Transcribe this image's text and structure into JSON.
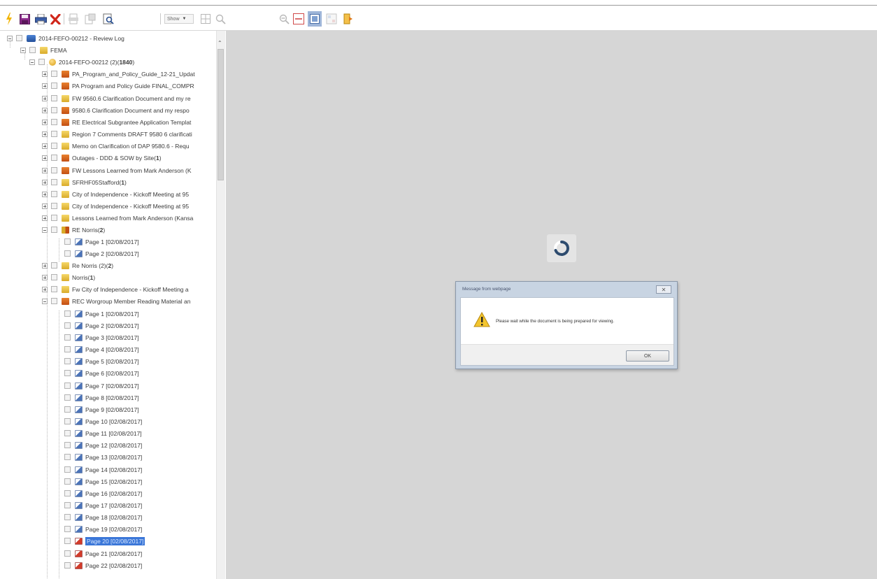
{
  "toolbar": {
    "show_label": "Show",
    "icons": [
      "lightning-icon",
      "save-icon",
      "print-icon",
      "delete-icon",
      "print-preview-icon",
      "export-icon",
      "search-document-icon",
      "grid-icon",
      "zoom-icon",
      "zoom-out-icon",
      "fit-width-icon",
      "fit-page-icon",
      "thumbnails-icon",
      "exit-icon"
    ]
  },
  "tree": {
    "root": "2014-FEFO-00212 - Review Log",
    "folder": "FEMA",
    "case_name": "2014-FEFO-00212 (2)(",
    "case_count": "1840",
    "items": [
      {
        "label": "PA_Program_and_Policy_Guide_12-21_Updat",
        "count": ""
      },
      {
        "label": "PA Program and Policy Guide FINAL_COMPR",
        "count": ""
      },
      {
        "label": "FW 9560.6 Clarification Document and my re",
        "count": ""
      },
      {
        "label": "9580.6 Clarification Document and my respo",
        "count": ""
      },
      {
        "label": "RE Electrical Subgrantee Application Templat",
        "count": ""
      },
      {
        "label": "Region 7 Comments DRAFT 9580 6 clarificati",
        "count": ""
      },
      {
        "label": "Memo on Clarification of DAP 9580.6 - Requ",
        "count": ""
      },
      {
        "label": "Outages - DDD & SOW by Site(",
        "count": "1"
      },
      {
        "label": "FW Lessons Learned from Mark Anderson (K",
        "count": ""
      },
      {
        "label": "SFRHF05Stafford(",
        "count": "1"
      },
      {
        "label": "City of Independence - Kickoff Meeting at 95",
        "count": ""
      },
      {
        "label": "City of Independence - Kickoff Meeting at 95",
        "count": ""
      },
      {
        "label": "Lessons Learned from Mark Anderson (Kansa",
        "count": ""
      },
      {
        "label": "RE Norris(",
        "count": "2"
      }
    ],
    "norris_pages": [
      "Page 1 [02/08/2017]",
      "Page 2 [02/08/2017]"
    ],
    "items_after": [
      {
        "label": "Re Norris (2)(",
        "count": "2"
      },
      {
        "label": "Norris(",
        "count": "1"
      },
      {
        "label": "Fw City of Independence - Kickoff Meeting a",
        "count": ""
      },
      {
        "label": "REC Worgroup Member Reading Material an",
        "count": ""
      }
    ],
    "rec_pages": [
      "Page 1 [02/08/2017]",
      "Page 2 [02/08/2017]",
      "Page 3 [02/08/2017]",
      "Page 4 [02/08/2017]",
      "Page 5 [02/08/2017]",
      "Page 6 [02/08/2017]",
      "Page 7 [02/08/2017]",
      "Page 8 [02/08/2017]",
      "Page 9 [02/08/2017]",
      "Page 10 [02/08/2017]",
      "Page 11 [02/08/2017]",
      "Page 12 [02/08/2017]",
      "Page 13 [02/08/2017]",
      "Page 14 [02/08/2017]",
      "Page 15 [02/08/2017]",
      "Page 16 [02/08/2017]",
      "Page 17 [02/08/2017]",
      "Page 18 [02/08/2017]",
      "Page 19 [02/08/2017]",
      "Page 20 [02/08/2017]",
      "Page 21 [02/08/2017]",
      "Page 22 [02/08/2017]"
    ]
  },
  "dialog": {
    "title": "Message from webpage",
    "close": "✕",
    "message": "Please wait while the document is being prepared for viewing.",
    "ok_label": "OK"
  },
  "colors": {
    "viewer_bg": "#d6d6d6",
    "selection": "#3b77d8",
    "dialog_frame": "#c8d4e2"
  }
}
